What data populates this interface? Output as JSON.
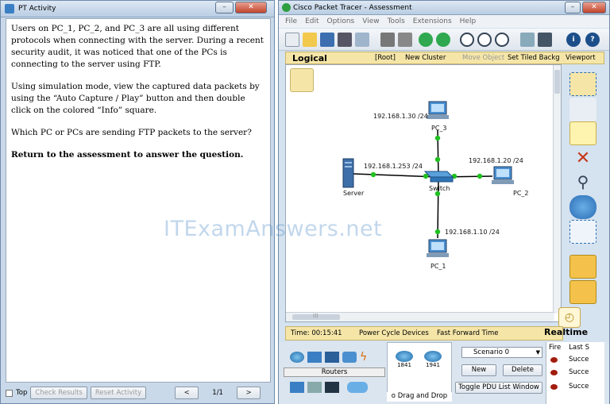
{
  "left_window": {
    "title": "PT Activity",
    "paragraphs": [
      "Users on PC_1, PC_2, and PC_3 are all using different protocols when connecting with the server. During a recent security audit, it was noticed that one of the PCs is connecting to the server using FTP.",
      "Using simulation mode, view the captured data packets by using the “Auto Capture / Play” button and then double click on the colored “Info” square.",
      "Which PC or PCs are sending FTP packets to the server?",
      "Return to the assessment to answer the question."
    ],
    "bottom": {
      "top_label": "Top",
      "check_results": "Check Results",
      "reset_activity": "Reset Activity",
      "prev": "<",
      "page": "1/1",
      "next": ">"
    }
  },
  "right_window": {
    "title": "Cisco Packet Tracer - Assessment",
    "menu": [
      "File",
      "Edit",
      "Options",
      "View",
      "Tools",
      "Extensions",
      "Help"
    ],
    "logical_bar": {
      "mode": "Logical",
      "root": "[Root]",
      "new_cluster": "New Cluster",
      "move_object": "Move Object",
      "set_tiled": "Set Tiled Backg",
      "viewport": "Viewport"
    },
    "network": {
      "devices": {
        "server": "Server",
        "switch": "Switch",
        "pc1": "PC_1",
        "pc2": "PC_2",
        "pc3": "PC_3"
      },
      "ips": {
        "server": "192.168.1.253 /24",
        "pc1": "192.168.1.10 /24",
        "pc2": "192.168.1.20 /24",
        "pc3": "192.168.1.30 /24"
      }
    },
    "time_bar": {
      "time": "Time: 00:15:41",
      "power_cycle": "Power Cycle Devices",
      "fast_forward": "Fast Forward Time",
      "mode": "Realtime"
    },
    "bottom_panel": {
      "category_label": "Routers",
      "models": [
        "1841",
        "1941"
      ],
      "model_caption": "o Drag and Drop",
      "scenario": "Scenario 0",
      "new_btn": "New",
      "delete_btn": "Delete",
      "toggle_pdu": "Toggle PDU List Window",
      "pdu_headers": [
        "Fire",
        "Last S"
      ],
      "pdu_rows": [
        "Succe",
        "Succe",
        "Succe"
      ]
    }
  },
  "watermark": "ITExamAnswers.net",
  "colors": {
    "link_dot": "#20c020",
    "pc_blue": "#4a8fd0",
    "accent_bar": "#f5e6a8"
  }
}
